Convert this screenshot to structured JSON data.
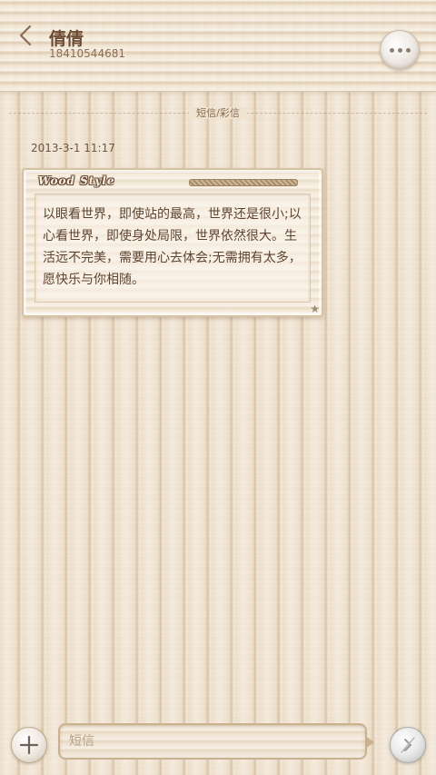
{
  "header": {
    "back_icon": "chevron-left-icon",
    "contact_name": "倩倩",
    "contact_number": "18410544681",
    "more_icon": "more-dots-icon"
  },
  "thread": {
    "type_label": "短信/彩信",
    "messages": [
      {
        "timestamp": "2013-3-1 11:17",
        "bubble_brand": "Wood Style",
        "text": "以眼看世界，即使站的最高，世界还是很小;以心看世界，即使身处局限，世界依然很大。生活远不完美，需要用心去体会;无需拥有太多，愿快乐与你相随。",
        "star_icon": "star-icon"
      }
    ]
  },
  "composer": {
    "add_icon": "plus-icon",
    "input_placeholder": "短信",
    "send_icon": "send-icon"
  },
  "colors": {
    "wood_light": "#efe2cf",
    "text_brown": "#6b4a33",
    "border_tan": "#c9b190"
  }
}
